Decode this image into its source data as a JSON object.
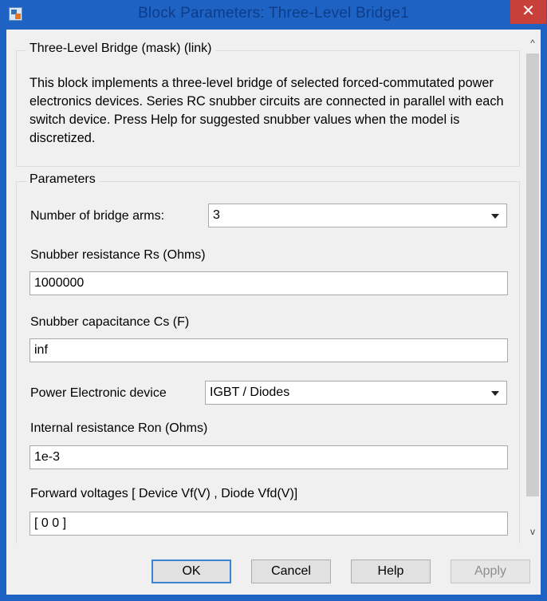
{
  "window": {
    "title": "Block Parameters: Three-Level Bridge1",
    "close_glyph": "✕",
    "app_icon": "simulink-block-icon"
  },
  "mask_group": {
    "legend": "Three-Level Bridge (mask) (link)",
    "description": "This block implements a three-level bridge of selected forced-commutated power electronics devices.  Series RC snubber circuits are connected in parallel with each switch device.  Press Help for suggested snubber values when the model is discretized."
  },
  "parameters_group": {
    "legend": "Parameters",
    "bridge_arms": {
      "label": "Number of bridge arms:",
      "value": "3"
    },
    "snubber_resistance": {
      "label": "Snubber resistance Rs (Ohms)",
      "value": "1000000"
    },
    "snubber_capacitance": {
      "label": "Snubber capacitance Cs (F)",
      "value": "inf"
    },
    "device": {
      "label": "Power Electronic device",
      "value": "IGBT / Diodes"
    },
    "internal_resistance": {
      "label": "Internal resistance Ron (Ohms)",
      "value": "1e-3"
    },
    "forward_voltages": {
      "label": "Forward voltages  [ Device Vf(V) , Diode Vfd(V)]",
      "value": "[ 0  0 ]"
    }
  },
  "scrollbar": {
    "up_glyph": "^",
    "down_glyph": "v"
  },
  "buttons": {
    "ok": "OK",
    "cancel": "Cancel",
    "help": "Help",
    "apply": "Apply"
  },
  "colors": {
    "titlebar": "#1e63c4",
    "close": "#c7403a",
    "dialog_bg": "#f0f0f0"
  }
}
